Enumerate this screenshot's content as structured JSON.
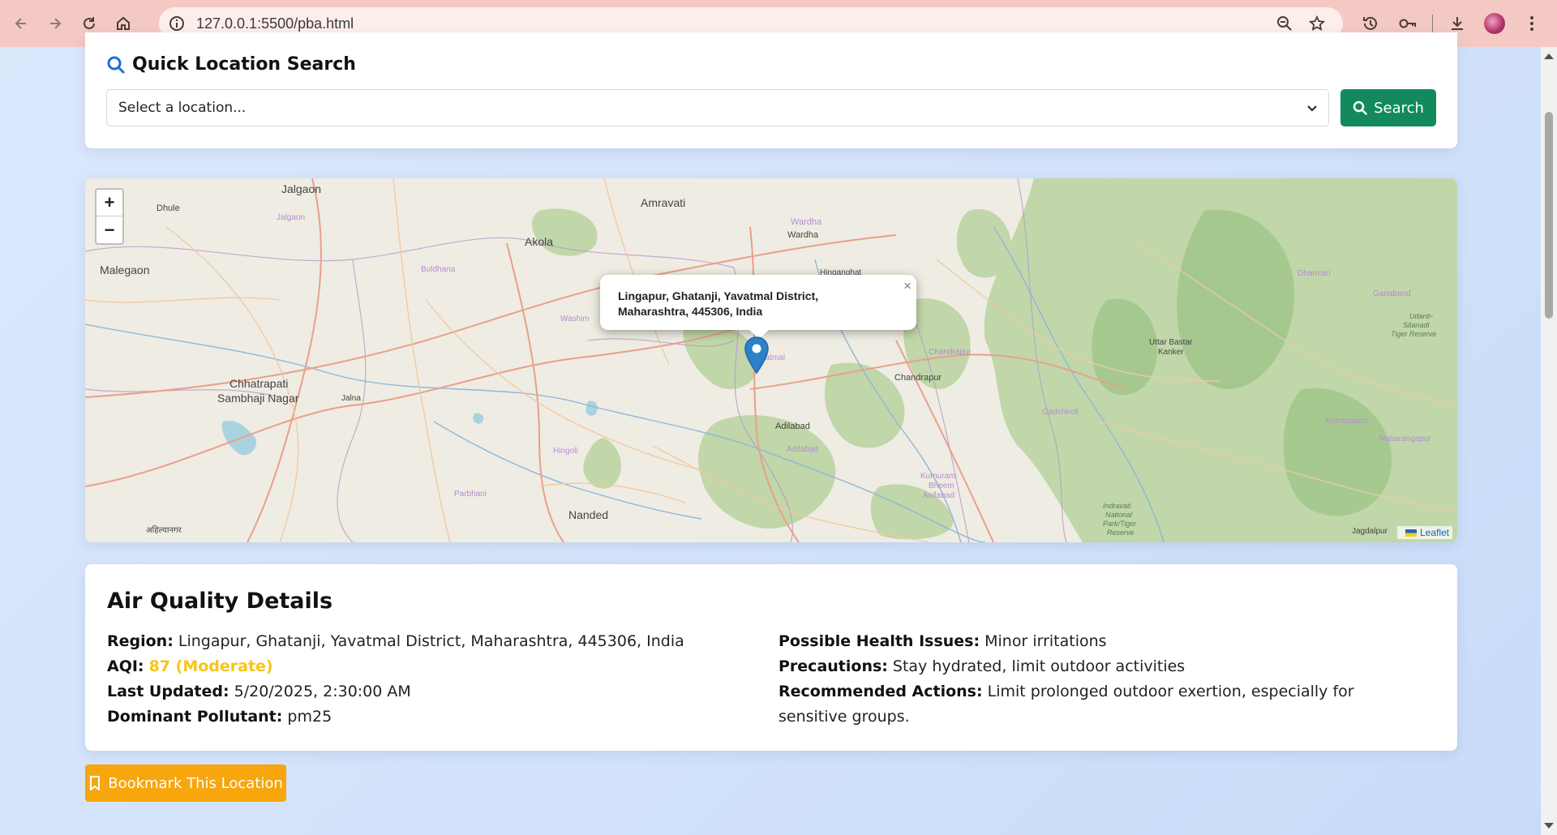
{
  "browser": {
    "url": "127.0.0.1:5500/pba.html"
  },
  "search": {
    "title": "Quick Location Search",
    "select_placeholder": "Select a location...",
    "button_label": "Search"
  },
  "map": {
    "labels": {
      "jalgaon": "Jalgaon",
      "jalgaon_small": "Jalgaon",
      "dhule": "Dhule",
      "amravati": "Amravati",
      "wardha": "Wardha",
      "wardha_small": "Wardha",
      "akola": "Akola",
      "malegaon": "Malegaon",
      "buldhana": "Buldhana",
      "hinganghat": "Hinganghat",
      "washim": "Washim",
      "yavatmal": "Yavatmal",
      "chandrapur_small": "Chandrapur",
      "chandrapur": "Chandrapur",
      "chhatrapati1": "Chhatrapati",
      "chhatrapati2": "Sambhaji Nagar",
      "jalna": "Jalna",
      "hingoli": "Hingoli",
      "adilabad": "Adilabad",
      "adilabad_small": "Adilabad",
      "parbhani": "Parbhani",
      "nanded": "Nanded",
      "ahmednagar": "अहिल्यानगर",
      "dhamtari": "Dhamtari",
      "gariaband": "Gariaband",
      "udanti1": "Udanti-",
      "udanti2": "Sitanadi",
      "udanti3": "Tiger Reserve",
      "uttar1": "Uttar Bastar",
      "uttar2": "Kanker",
      "gadchiroli": "Gadchiroli",
      "kondagaon": "Kondagaon",
      "narayanpur": "Nabarangapur",
      "kumuram1": "Kumuram",
      "kumuram2": "Bheem",
      "kumuram3": "Asifabad",
      "indravati1": "Indravati",
      "indravati2": "National",
      "indravati3": "Park/Tiger",
      "indravati4": "Reserve",
      "jagdalpur": "Jagdalpur"
    },
    "zoom_in": "+",
    "zoom_out": "−",
    "popup_text": "Lingapur, Ghatanji, Yavatmal District, Maharashtra, 445306, India",
    "popup_close": "×",
    "attribution": "Leaflet"
  },
  "air_quality": {
    "title": "Air Quality Details",
    "region_label": "Region:",
    "region_value": "Lingapur, Ghatanji, Yavatmal District, Maharashtra, 445306, India",
    "aqi_label": "AQI:",
    "aqi_value": "87 (Moderate)",
    "updated_label": "Last Updated:",
    "updated_value": "5/20/2025, 2:30:00 AM",
    "pollutant_label": "Dominant Pollutant:",
    "pollutant_value": "pm25",
    "health_label": "Possible Health Issues:",
    "health_value": "Minor irritations",
    "precautions_label": "Precautions:",
    "precautions_value": "Stay hydrated, limit outdoor activities",
    "actions_label": "Recommended Actions:",
    "actions_value": "Limit prolonged outdoor exertion, especially for sensitive groups.",
    "aqi_color": "#f5c518"
  },
  "bookmark": {
    "label": "Bookmark This Location"
  },
  "colors": {
    "search_button": "#128a5e",
    "bookmark_button": "#f7a60d",
    "chrome": "#f4c9c4"
  }
}
